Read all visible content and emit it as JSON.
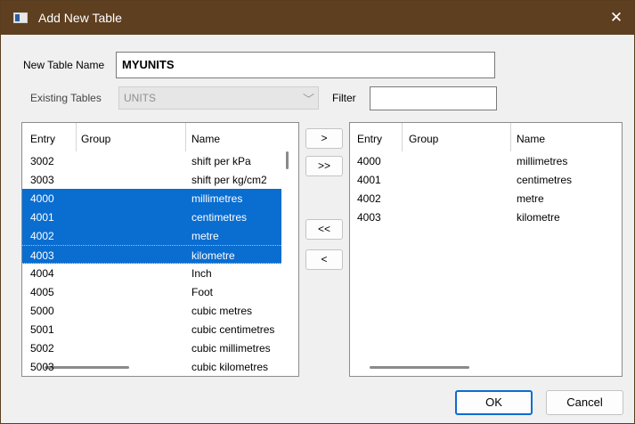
{
  "window": {
    "title": "Add New Table",
    "close_label": "✕"
  },
  "form": {
    "new_table_label": "New Table Name",
    "new_table_value": "MYUNITS",
    "existing_tables_label": "Existing Tables",
    "existing_tables_value": "UNITS",
    "filter_label": "Filter",
    "filter_value": ""
  },
  "left_list": {
    "columns": [
      "Entry",
      "Group",
      "Name"
    ],
    "rows": [
      {
        "entry": "3002",
        "group": "",
        "name": "shift per kPa",
        "selected": false
      },
      {
        "entry": "3003",
        "group": "",
        "name": "shift per kg/cm2",
        "selected": false
      },
      {
        "entry": "4000",
        "group": "",
        "name": "millimetres",
        "selected": true
      },
      {
        "entry": "4001",
        "group": "",
        "name": "centimetres",
        "selected": true
      },
      {
        "entry": "4002",
        "group": "",
        "name": "metre",
        "selected": true
      },
      {
        "entry": "4003",
        "group": "",
        "name": "kilometre",
        "selected": true
      },
      {
        "entry": "4004",
        "group": "",
        "name": "Inch",
        "selected": false
      },
      {
        "entry": "4005",
        "group": "",
        "name": "Foot",
        "selected": false
      },
      {
        "entry": "5000",
        "group": "",
        "name": "cubic metres",
        "selected": false
      },
      {
        "entry": "5001",
        "group": "",
        "name": "cubic centimetres",
        "selected": false
      },
      {
        "entry": "5002",
        "group": "",
        "name": "cubic millimetres",
        "selected": false
      },
      {
        "entry": "5003",
        "group": "",
        "name": "cubic kilometres",
        "selected": false
      }
    ]
  },
  "transfer_buttons": {
    "add_one": ">",
    "add_all": ">>",
    "remove_all": "<<",
    "remove_one": "<"
  },
  "right_list": {
    "columns": [
      "Entry",
      "Group",
      "Name"
    ],
    "rows": [
      {
        "entry": "4000",
        "group": "",
        "name": "millimetres"
      },
      {
        "entry": "4001",
        "group": "",
        "name": "centimetres"
      },
      {
        "entry": "4002",
        "group": "",
        "name": "metre"
      },
      {
        "entry": "4003",
        "group": "",
        "name": "kilometre"
      }
    ]
  },
  "footer": {
    "ok_label": "OK",
    "cancel_label": "Cancel"
  },
  "colors": {
    "titlebar": "#5e3f20",
    "selection": "#0a6dd0",
    "window_bg": "#f0f0f0"
  }
}
